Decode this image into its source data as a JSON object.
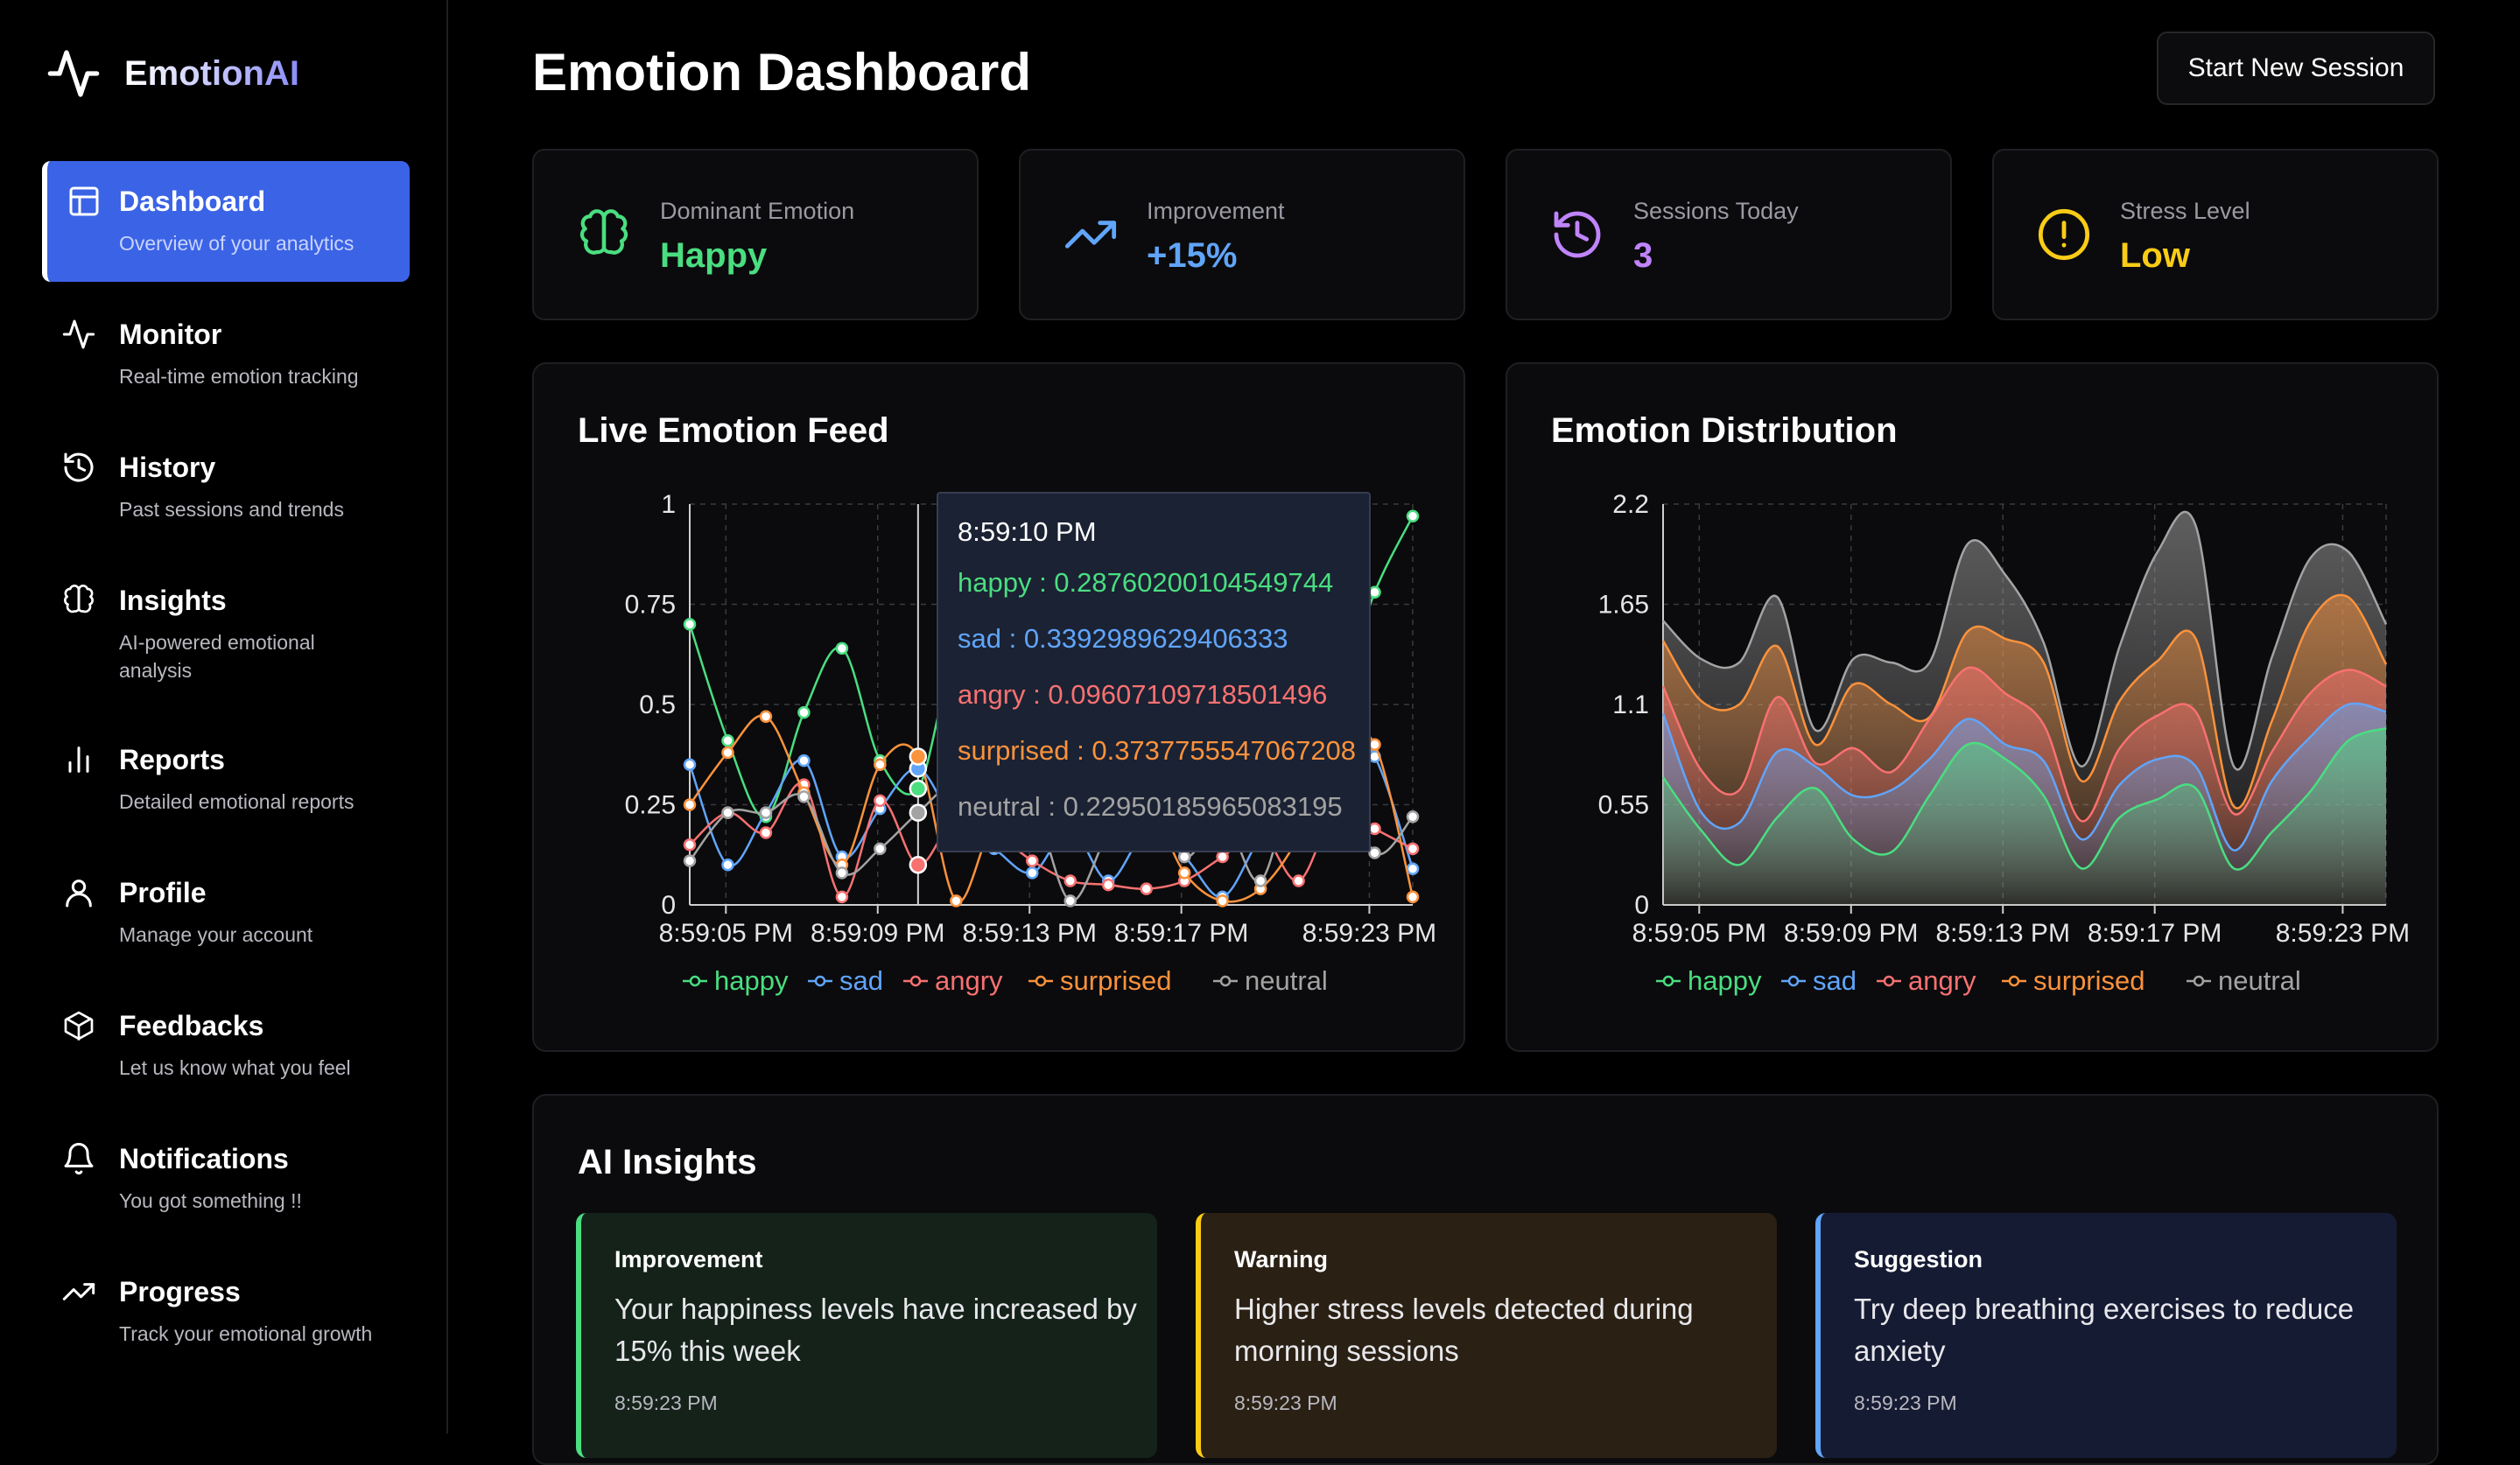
{
  "app": {
    "name": "EmotionAI"
  },
  "sidebar": {
    "items": [
      {
        "label": "Dashboard",
        "desc": "Overview of your analytics",
        "icon": "layout-icon"
      },
      {
        "label": "Monitor",
        "desc": "Real-time emotion tracking",
        "icon": "pulse-icon"
      },
      {
        "label": "History",
        "desc": "Past sessions and trends",
        "icon": "history-icon"
      },
      {
        "label": "Insights",
        "desc": "AI-powered emotional analysis",
        "icon": "brain-icon"
      },
      {
        "label": "Reports",
        "desc": "Detailed emotional reports",
        "icon": "bar-chart-icon"
      },
      {
        "label": "Profile",
        "desc": "Manage your account",
        "icon": "user-icon"
      },
      {
        "label": "Feedbacks",
        "desc": "Let us know what you feel",
        "icon": "box-icon"
      },
      {
        "label": "Notifications",
        "desc": "You got something !!",
        "icon": "bell-icon"
      },
      {
        "label": "Progress",
        "desc": "Track your emotional growth",
        "icon": "trending-up-icon"
      }
    ]
  },
  "header": {
    "title": "Emotion Dashboard",
    "button": "Start New Session"
  },
  "stats": [
    {
      "label": "Dominant Emotion",
      "value": "Happy",
      "color": "#4ade80",
      "icon": "brain-icon"
    },
    {
      "label": "Improvement",
      "value": "+15%",
      "color": "#60a5fa",
      "icon": "trending-up-icon"
    },
    {
      "label": "Sessions Today",
      "value": "3",
      "color": "#c084fc",
      "icon": "history-icon"
    },
    {
      "label": "Stress Level",
      "value": "Low",
      "color": "#facc15",
      "icon": "alert-circle-icon"
    }
  ],
  "live_feed": {
    "title": "Live Emotion Feed",
    "tooltip": {
      "time": "8:59:10 PM",
      "rows": [
        {
          "text": "happy : 0.28760200104549744",
          "color": "#4ade80"
        },
        {
          "text": "sad : 0.3392989629406333",
          "color": "#60a5fa"
        },
        {
          "text": "angry : 0.09607109718501496",
          "color": "#f87171"
        },
        {
          "text": "surprised : 0.3737755547067208",
          "color": "#fb923c"
        },
        {
          "text": "neutral : 0.22950185965083195",
          "color": "#a3a3a3"
        }
      ]
    }
  },
  "distribution": {
    "title": "Emotion Distribution"
  },
  "chart_data": [
    {
      "type": "line",
      "title": "Live Emotion Feed",
      "ylim": [
        0,
        1
      ],
      "yticks": [
        "0",
        "0.25",
        "0.5",
        "0.75",
        "1"
      ],
      "xticks": [
        "8:59:05 PM",
        "8:59:09 PM",
        "8:59:13 PM",
        "8:59:17 PM",
        "8:59:23 PM"
      ],
      "x": [
        0,
        1,
        2,
        3,
        4,
        5,
        6,
        7,
        8,
        9,
        10,
        11,
        12,
        13,
        14,
        15,
        16,
        17,
        18,
        19
      ],
      "series": [
        {
          "name": "happy",
          "color": "#4ade80",
          "values": [
            0.7,
            0.41,
            0.22,
            0.48,
            0.64,
            0.36,
            0.29,
            0.6,
            0.28,
            0.3,
            0.42,
            0.25,
            0.21,
            0.4,
            0.49,
            0.33,
            0.38,
            0.5,
            0.78,
            0.97
          ]
        },
        {
          "name": "sad",
          "color": "#60a5fa",
          "values": [
            0.35,
            0.1,
            0.23,
            0.36,
            0.12,
            0.24,
            0.34,
            0.2,
            0.14,
            0.08,
            0.19,
            0.06,
            0.18,
            0.12,
            0.02,
            0.17,
            0.28,
            0.44,
            0.37,
            0.09
          ]
        },
        {
          "name": "angry",
          "color": "#f87171",
          "values": [
            0.15,
            0.23,
            0.18,
            0.3,
            0.02,
            0.26,
            0.1,
            0.22,
            0.18,
            0.11,
            0.06,
            0.05,
            0.04,
            0.06,
            0.12,
            0.18,
            0.06,
            0.24,
            0.19,
            0.14
          ]
        },
        {
          "name": "surprised",
          "color": "#fb923c",
          "values": [
            0.25,
            0.38,
            0.47,
            0.28,
            0.1,
            0.35,
            0.37,
            0.01,
            0.2,
            0.15,
            0.34,
            0.22,
            0.26,
            0.08,
            0.01,
            0.04,
            0.17,
            0.39,
            0.4,
            0.02
          ]
        },
        {
          "name": "neutral",
          "color": "#a3a3a3",
          "values": [
            0.11,
            0.23,
            0.23,
            0.27,
            0.08,
            0.14,
            0.23,
            0.3,
            0.21,
            0.25,
            0.01,
            0.18,
            0.3,
            0.12,
            0.22,
            0.06,
            0.35,
            0.37,
            0.13,
            0.22
          ]
        }
      ]
    },
    {
      "type": "area",
      "title": "Emotion Distribution",
      "stacked": true,
      "ylim": [
        0,
        2.2
      ],
      "yticks": [
        "0",
        "0.55",
        "1.1",
        "1.65",
        "2.2"
      ],
      "xticks": [
        "8:59:05 PM",
        "8:59:09 PM",
        "8:59:13 PM",
        "8:59:17 PM",
        "8:59:23 PM"
      ],
      "x": [
        0,
        1,
        2,
        3,
        4,
        5,
        6,
        7,
        8,
        9,
        10,
        11,
        12,
        13,
        14,
        15,
        16,
        17,
        18,
        19
      ],
      "series": [
        {
          "name": "happy",
          "color": "#4ade80",
          "values": [
            0.7,
            0.41,
            0.22,
            0.48,
            0.64,
            0.36,
            0.29,
            0.6,
            0.88,
            0.8,
            0.6,
            0.2,
            0.48,
            0.58,
            0.64,
            0.2,
            0.4,
            0.62,
            0.9,
            0.97
          ]
        },
        {
          "name": "sad",
          "color": "#60a5fa",
          "values": [
            0.35,
            0.1,
            0.23,
            0.36,
            0.12,
            0.24,
            0.34,
            0.2,
            0.14,
            0.08,
            0.19,
            0.16,
            0.18,
            0.22,
            0.12,
            0.1,
            0.28,
            0.3,
            0.2,
            0.09
          ]
        },
        {
          "name": "angry",
          "color": "#f87171",
          "values": [
            0.15,
            0.23,
            0.18,
            0.3,
            0.02,
            0.26,
            0.1,
            0.22,
            0.28,
            0.28,
            0.2,
            0.1,
            0.2,
            0.24,
            0.3,
            0.2,
            0.16,
            0.24,
            0.19,
            0.14
          ]
        },
        {
          "name": "surprised",
          "color": "#fb923c",
          "values": [
            0.25,
            0.38,
            0.47,
            0.28,
            0.1,
            0.35,
            0.37,
            0.01,
            0.2,
            0.3,
            0.34,
            0.22,
            0.26,
            0.3,
            0.4,
            0.04,
            0.17,
            0.39,
            0.4,
            0.12
          ]
        },
        {
          "name": "neutral",
          "color": "#a3a3a3",
          "values": [
            0.11,
            0.23,
            0.23,
            0.27,
            0.08,
            0.14,
            0.23,
            0.3,
            0.48,
            0.35,
            0.11,
            0.08,
            0.3,
            0.6,
            0.62,
            0.22,
            0.35,
            0.35,
            0.25,
            0.22
          ]
        }
      ]
    }
  ],
  "insights": {
    "title": "AI Insights",
    "cards": [
      {
        "type": "Improvement",
        "text": "Your happiness levels have increased by 15% this week",
        "time": "8:59:23 PM",
        "accent": "#4ade80",
        "bg": "#14221a"
      },
      {
        "type": "Warning",
        "text": "Higher stress levels detected during morning sessions",
        "time": "8:59:23 PM",
        "accent": "#facc15",
        "bg": "#2a2014"
      },
      {
        "type": "Suggestion",
        "text": "Try deep breathing exercises to reduce anxiety",
        "time": "8:59:23 PM",
        "accent": "#60a5fa",
        "bg": "#151b33"
      }
    ]
  }
}
